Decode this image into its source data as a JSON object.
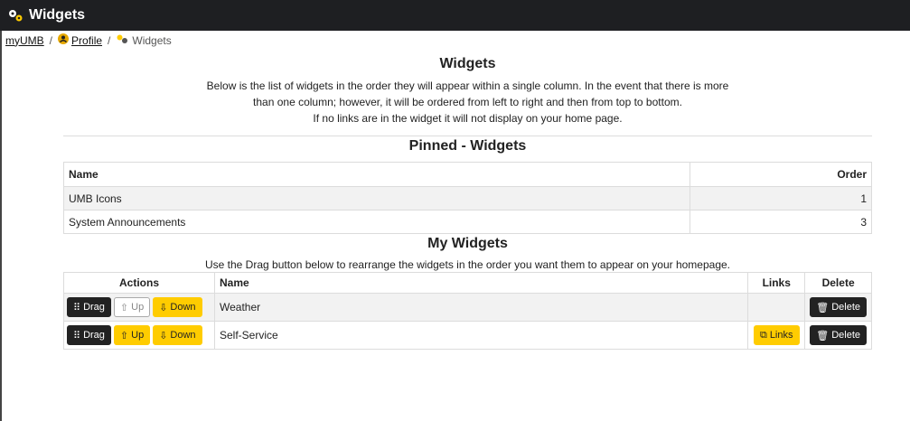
{
  "app": {
    "title": "Widgets"
  },
  "breadcrumb": {
    "home": "myUMB",
    "sep1": "/",
    "profile": "Profile",
    "sep2": "/",
    "current": "Widgets"
  },
  "page": {
    "heading": "Widgets",
    "intro_line1": "Below is the list of widgets in the order they will appear within a single column. In the event that there is more",
    "intro_line2": "than one column; however, it will be ordered from left to right and then from top to bottom.",
    "intro_line3": "If no links are in the widget it will not display on your home page."
  },
  "pinned": {
    "title": "Pinned - Widgets",
    "col_name": "Name",
    "col_order": "Order",
    "rows": [
      {
        "name": "UMB Icons",
        "order": "1"
      },
      {
        "name": "System Announcements",
        "order": "3"
      }
    ]
  },
  "mine": {
    "title": "My Widgets",
    "hint": "Use the Drag button below to rearrange the widgets in the order you want them to appear on your homepage.",
    "col_actions": "Actions",
    "col_name": "Name",
    "col_links": "Links",
    "col_delete": "Delete",
    "rows": [
      {
        "drag": "Drag",
        "up": "Up",
        "down": "Down",
        "name": "Weather",
        "links": "",
        "delete": "Delete",
        "up_enabled": false
      },
      {
        "drag": "Drag",
        "up": "Up",
        "down": "Down",
        "name": "Self-Service",
        "links": "Links",
        "delete": "Delete",
        "up_enabled": true
      }
    ]
  },
  "colors": {
    "accent": "#ffcc00",
    "dark": "#222222",
    "titlebar": "#1e1f22"
  },
  "icons": [
    "gears-icon",
    "user-circle-icon",
    "grip-icon",
    "arrow-up-icon",
    "arrow-down-icon",
    "external-link-icon",
    "trash-icon"
  ]
}
